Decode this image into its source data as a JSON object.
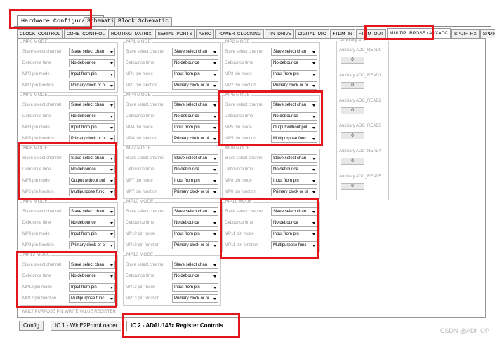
{
  "top_tabs": {
    "hardware": "Hardware Configuration",
    "schematic": "Schematic",
    "block": "Block Schematic"
  },
  "sub_tabs": [
    "CLOCK_CONTROL",
    "CORE_CONTROL",
    "ROUTING_MATRIX",
    "SERIAL_PORTS",
    "ASRC",
    "POWER_CLOCKING",
    "PIN_DRIVE",
    "DIGITAL_MIC",
    "FTDM_IN",
    "FTDM_OUT",
    "MULTIPURPOSE / AUXADC",
    "SPDIF_RX",
    "SPDIF_TX"
  ],
  "row_labels": [
    "Slave select channel",
    "Debounce time",
    "pin mode",
    "pin function"
  ],
  "groups": [
    {
      "title": "MP0 MODE",
      "vals": [
        "Slave select chan",
        "No debounce",
        "Input from pin",
        "Primary clock or oi"
      ]
    },
    {
      "title": "MP1 MODE",
      "vals": [
        "Slave select chan",
        "No debounce",
        "Input from pin",
        "Primary clock or oi"
      ]
    },
    {
      "title": "MP2 MODE",
      "vals": [
        "Slave select chan",
        "No debounce",
        "Input from pin",
        "Primary clock or oi"
      ]
    },
    {
      "title": "MP3 MODE",
      "vals": [
        "Slave select chan",
        "No debounce",
        "Input from pin",
        "Primary clock or oi"
      ]
    },
    {
      "title": "MP4 MODE",
      "vals": [
        "Slave select chan",
        "No debounce",
        "Input from pin",
        "Primary clock or oi"
      ]
    },
    {
      "title": "MP5 MODE",
      "vals": [
        "Slave select chan",
        "No debounce",
        "Output without pul",
        "Multipurpose func"
      ]
    },
    {
      "title": "MP6 MODE",
      "vals": [
        "Slave select chan",
        "No debounce",
        "Output without pul",
        "Multipurpose func"
      ]
    },
    {
      "title": "MP7 MODE",
      "vals": [
        "Slave select chan",
        "No debounce",
        "Input from pin",
        "Primary clock or oi"
      ]
    },
    {
      "title": "MP8 MODE",
      "vals": [
        "Slave select chan",
        "No debounce",
        "Input from pin",
        "Primary clock or oi"
      ]
    },
    {
      "title": "MP9 MODE",
      "vals": [
        "Slave select chan",
        "No debounce",
        "Input from pin",
        "Primary clock or oi"
      ]
    },
    {
      "title": "MP10 MODE",
      "vals": [
        "Slave select chan",
        "No debounce",
        "Input from pin",
        "Primary clock or oi"
      ]
    },
    {
      "title": "MP11 MODE",
      "vals": [
        "Slave select chan",
        "No debounce",
        "Input from pin",
        "Multipurpose func"
      ]
    },
    {
      "title": "MP12 MODE",
      "vals": [
        "Slave select chan",
        "No debounce",
        "Input from pin",
        "Multipurpose func"
      ]
    },
    {
      "title": "MP13 MODE",
      "vals": [
        "Slave select chan",
        "No debounce",
        "Input from pin",
        "Primary clock or oi"
      ]
    }
  ],
  "aux": {
    "title": "Auxiliary ADC",
    "items": [
      {
        "label": "Auxiliary ADC_READ0",
        "value": "0"
      },
      {
        "label": "Auxiliary ADC_READ1",
        "value": "0"
      },
      {
        "label": "Auxiliary ADC_READ2",
        "value": "0"
      },
      {
        "label": "Auxiliary ADC_READ3",
        "value": "0"
      },
      {
        "label": "Auxiliary ADC_READ4",
        "value": "0"
      },
      {
        "label": "Auxiliary ADC_READ5",
        "value": "0"
      }
    ]
  },
  "bottom_group": "MULTIPURPOSE PIN WRITE VALUE REGISTER",
  "bottom_tabs": [
    "Config",
    "IC 1 - WinE2PromLoader",
    "IC 2 - ADAU145x Register Controls"
  ],
  "watermark": "CSDN @ADI_OP",
  "highlight_color": "#e3161b"
}
